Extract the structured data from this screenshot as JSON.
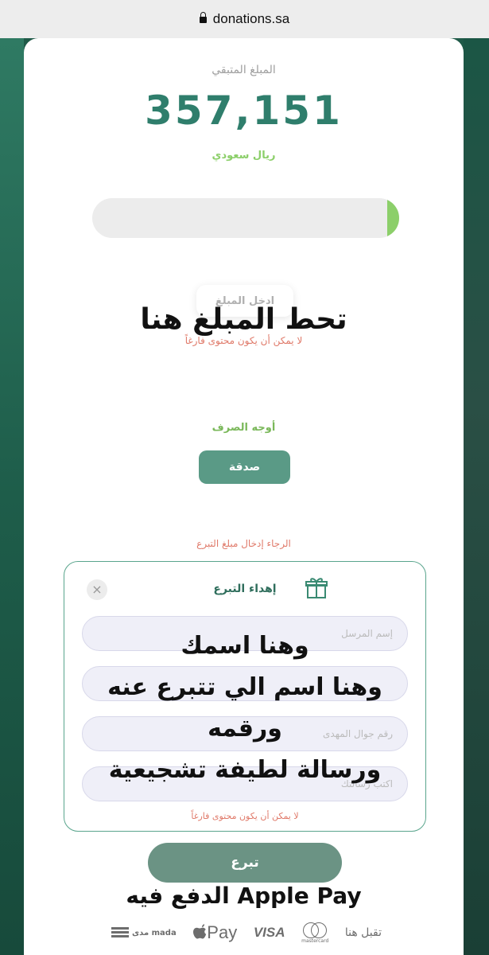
{
  "browser": {
    "url": "donations.sa"
  },
  "campaign": {
    "remaining_label": "المبلغ المتبقي",
    "remaining_value": "357,151",
    "currency": "ريال سعودي",
    "progress_fraction": 0.04
  },
  "amount": {
    "placeholder": "ادخل المبلغ",
    "overlay_note": "تحط المبلغ هنا",
    "error": "لا يمكن أن يكون محتوى فارغاً"
  },
  "spending": {
    "label": "أوجه الصرف",
    "option": "صدقة"
  },
  "amount_error": "الرجاء إدخال مبلغ التبرع",
  "gift": {
    "title": "إهداء التبرع",
    "fields": {
      "sender_name": "إسم المرسل",
      "recipient_phone": "رقم جوال المهدى",
      "message": "اكتب رسالتك"
    },
    "overlay_lines": [
      "وهنا اسمك",
      "وهنا اسم الي تتبرع عنه",
      "ورقمه",
      "ورسالة لطيفة تشجيعية"
    ],
    "error": "لا يمكن أن يكون محتوى فارغاً"
  },
  "donate_button": "تبرع",
  "apple_pay_note": "الدفع فيه Apple Pay",
  "payment": {
    "mada_ar": "مدى",
    "mada_en": "mada",
    "apple_pay": "Pay",
    "visa": "VISA",
    "mastercard": "mastercard",
    "accept_label": "تقبل هنا"
  },
  "colors": {
    "accent": "#2f7e6c",
    "light_green": "#8ccf6a",
    "error": "#e07a6a",
    "button": "#5a9a86"
  }
}
